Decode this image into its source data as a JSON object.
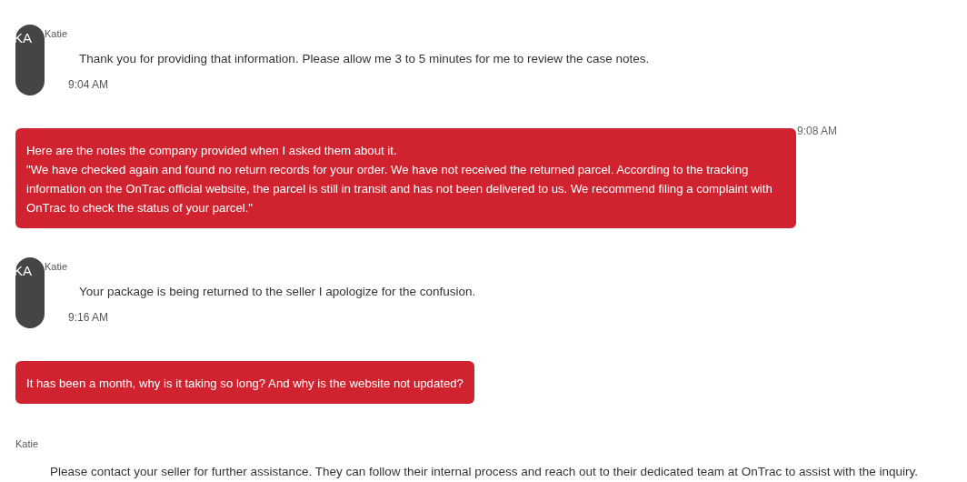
{
  "messages": [
    {
      "kind": "agent",
      "avatar": "KA",
      "sender": "Katie",
      "text": "Thank you for providing that information. Please allow me 3 to 5 minutes for me to review the case notes.",
      "time": "9:04 AM"
    },
    {
      "kind": "user",
      "time": "9:08 AM",
      "lines": [
        "Here are the notes the company provided when I asked them about it.",
        "\"We have checked again and found no return records for your order. We have not received the returned parcel. According to the tracking information on the OnTrac official website, the parcel is still in transit and has not been delivered to us. We recommend filing a complaint with OnTrac to check the status of your parcel.\""
      ]
    },
    {
      "kind": "agent",
      "avatar": "KA",
      "sender": "Katie",
      "text": "Your package is being returned to the seller I apologize for the confusion.",
      "time": "9:16 AM"
    },
    {
      "kind": "user",
      "lines": [
        "It has been a month, why is it taking so long? And why is the website not updated?"
      ]
    },
    {
      "kind": "agent",
      "sender": "Katie",
      "text": "Please contact your seller for further assistance. They can follow their internal process and reach out to their dedicated team at OnTrac to assist with the inquiry."
    }
  ]
}
